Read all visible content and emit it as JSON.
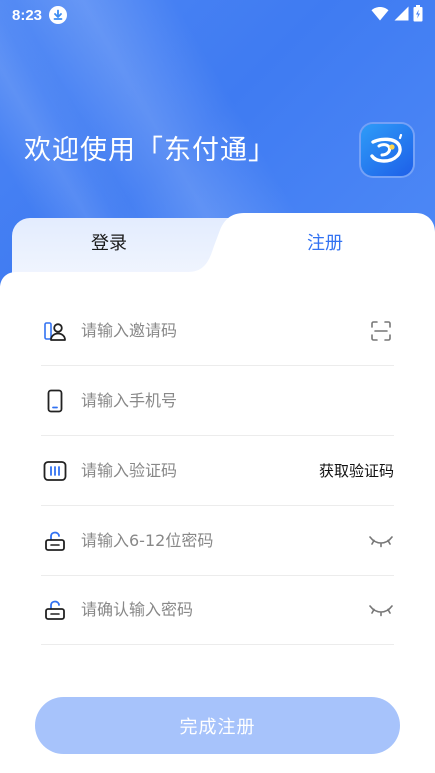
{
  "status_bar": {
    "time": "8:23"
  },
  "header": {
    "welcome": "欢迎使用「东付通」"
  },
  "tabs": {
    "login": "登录",
    "register": "注册"
  },
  "form": {
    "invite_code_placeholder": "请输入邀请码",
    "phone_placeholder": "请输入手机号",
    "code_placeholder": "请输入验证码",
    "get_code": "获取验证码",
    "password_placeholder": "请输入6-12位密码",
    "confirm_password_placeholder": "请确认输入密码"
  },
  "submit": {
    "label": "完成注册"
  },
  "colors": {
    "primary": "#3272f2",
    "hero": "#4d86f4",
    "button_disabled": "#a7c3fb"
  }
}
